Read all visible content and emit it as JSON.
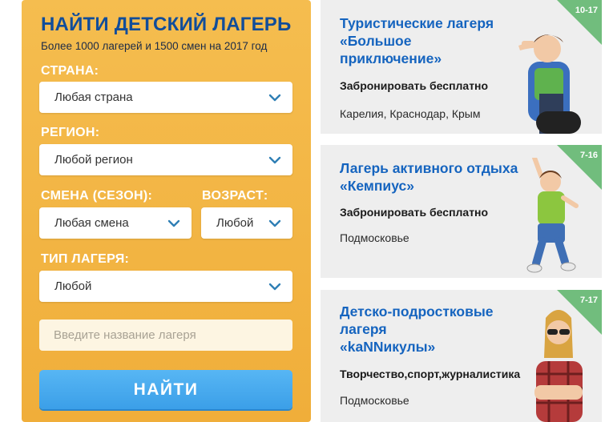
{
  "search": {
    "title": "НАЙТИ ДЕТСКИЙ ЛАГЕРЬ",
    "subtitle": "Более 1000 лагерей и 1500 смен на 2017 год",
    "country_label": "СТРАНА:",
    "country_value": "Любая страна",
    "region_label": "РЕГИОН:",
    "region_value": "Любой регион",
    "session_label": "СМЕНА (СЕЗОН):",
    "session_value": "Любая смена",
    "age_label": "ВОЗРАСТ:",
    "age_value": "Любой",
    "type_label": "ТИП ЛАГЕРЯ:",
    "type_value": "Любой",
    "name_placeholder": "Введите название лагеря",
    "find_label": "НАЙТИ"
  },
  "camps": [
    {
      "age": "10-17",
      "title_line1": "Туристические лагеря",
      "title_line2": "«Большое",
      "title_line3": "приключение»",
      "cta": "Забронировать бесплатно",
      "location": "Карелия, Краснодар, Крым"
    },
    {
      "age": "7-16",
      "title_line1": "Лагерь активного отдыха",
      "title_line2": "«Кемпиус»",
      "cta": "Забронировать бесплатно",
      "location": "Подмосковье"
    },
    {
      "age": "7-17",
      "title_line1": "Детско-подростковые",
      "title_line2": "лагеря",
      "title_line3": "«kaNNикулы»",
      "cta": "Творчество,спорт,журналистика",
      "location": "Подмосковье"
    }
  ],
  "colors": {
    "panel": "#f2b443",
    "title": "#114d9a",
    "card_title": "#1564bf",
    "age_badge": "#71bd7d",
    "button": "#4aabef"
  }
}
